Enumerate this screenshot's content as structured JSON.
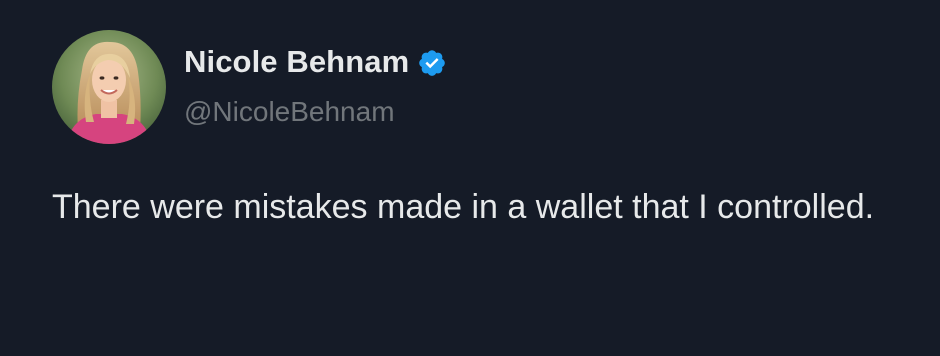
{
  "author": {
    "display_name": "Nicole Behnam",
    "handle": "@NicoleBehnam",
    "verified": true,
    "avatar_icon": "profile-photo"
  },
  "tweet": {
    "text": "There were mistakes made in a wallet that I controlled."
  },
  "colors": {
    "background": "#151b27",
    "primary_text": "#e7e9ea",
    "secondary_text": "#71767b",
    "verified_badge": "#1d9bf0"
  }
}
